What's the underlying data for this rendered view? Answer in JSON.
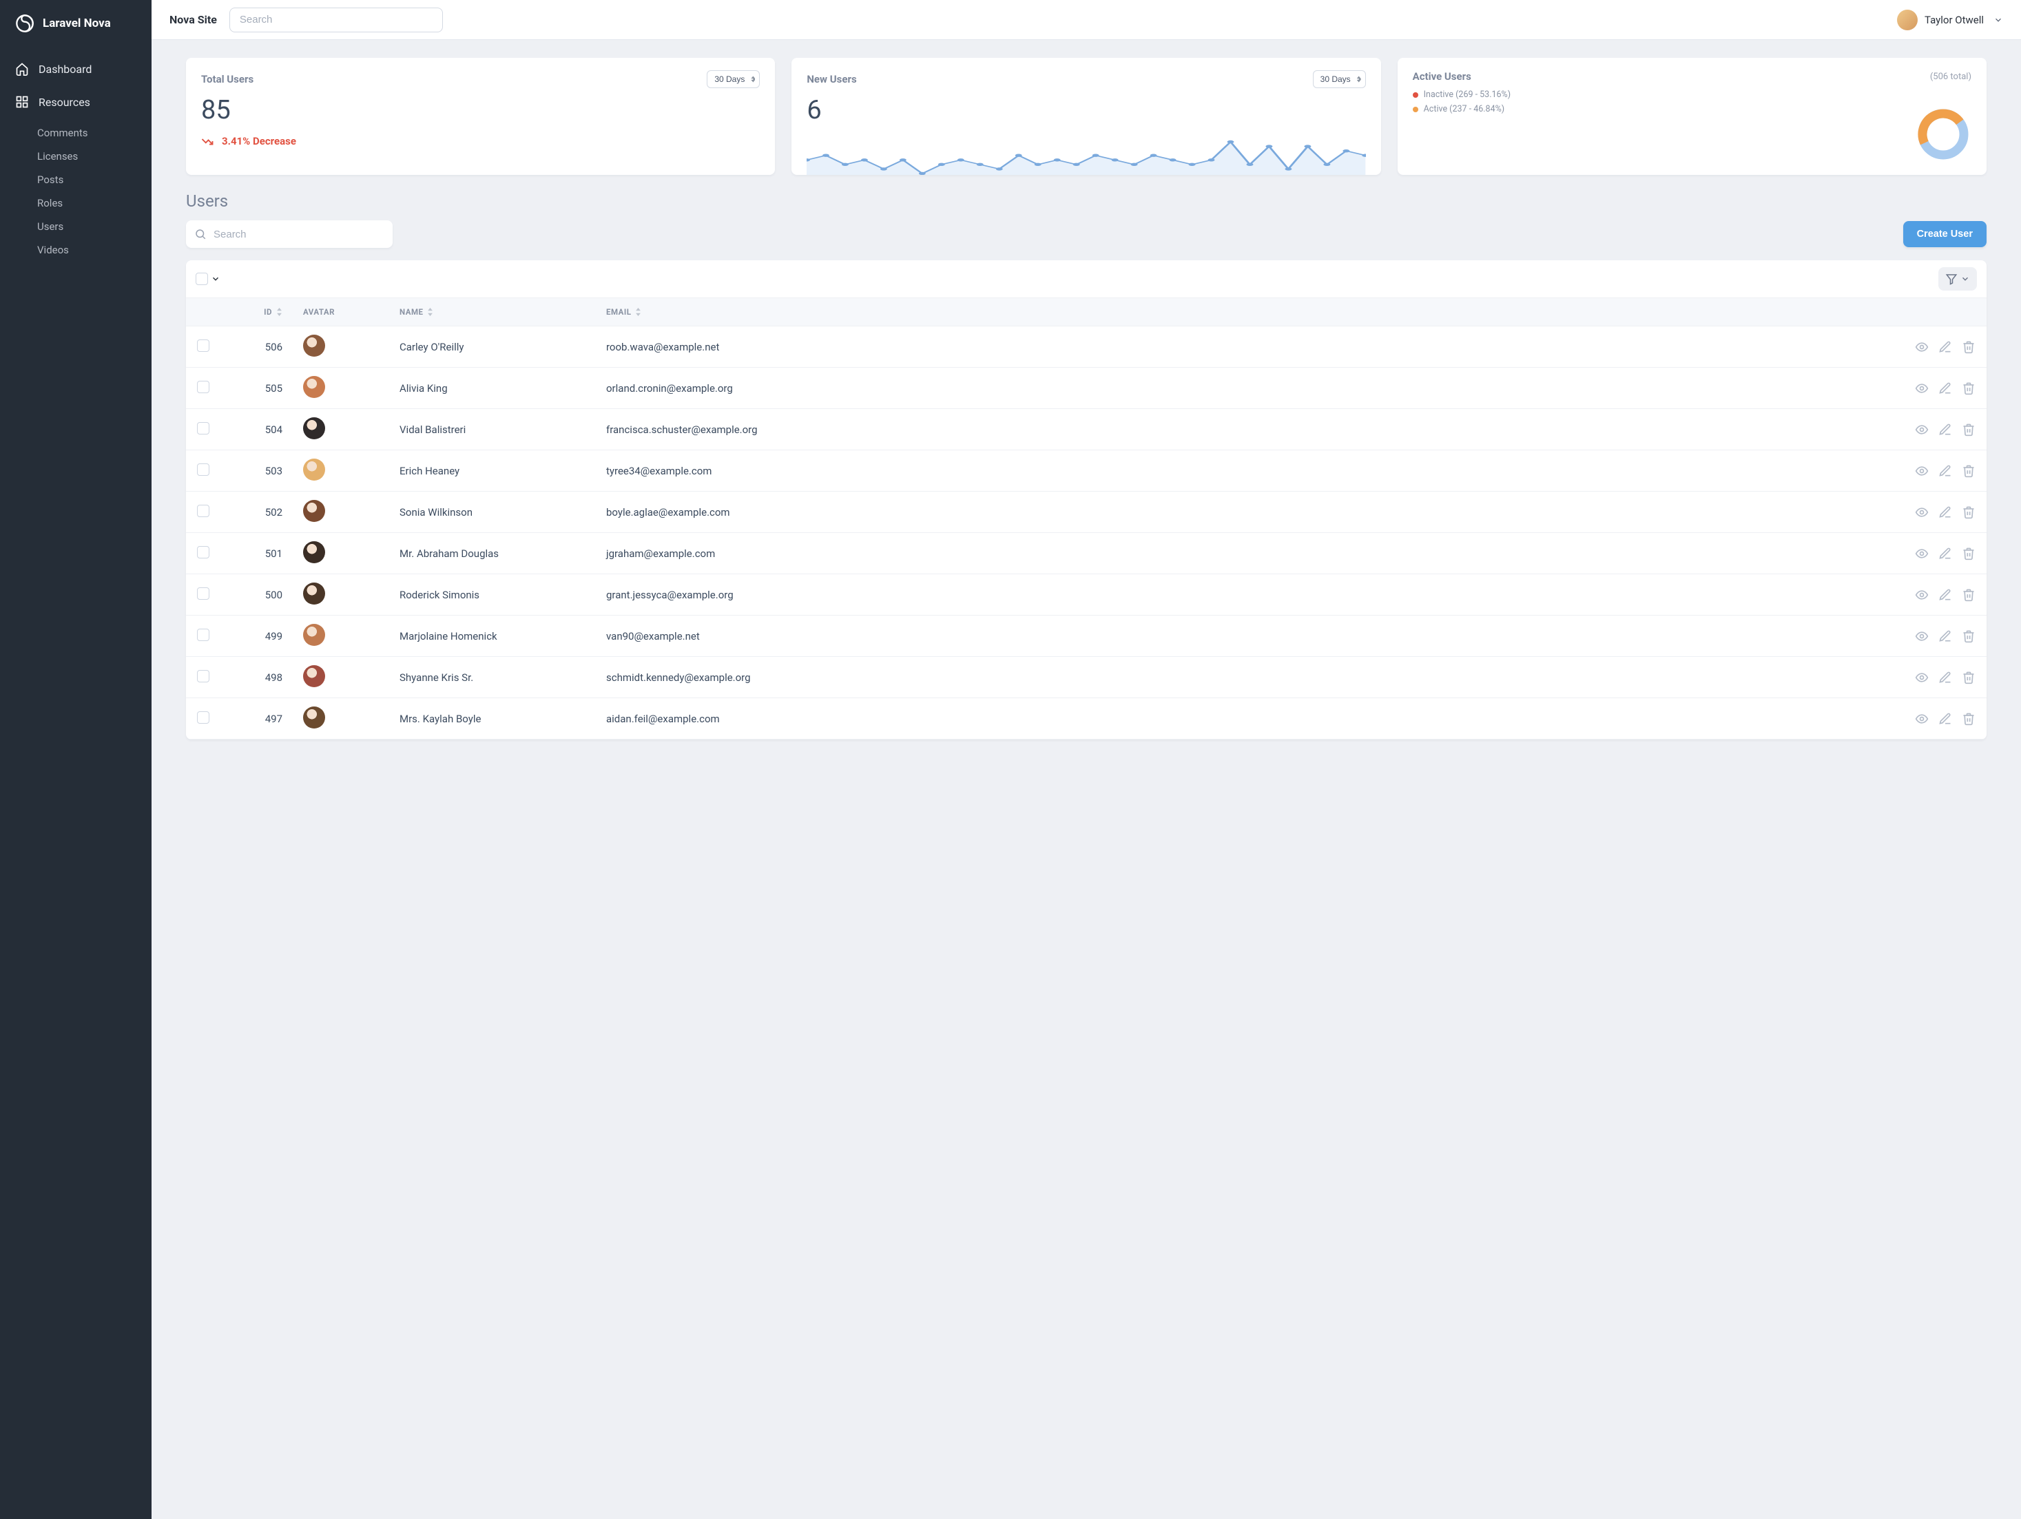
{
  "brand": {
    "name": "Laravel Nova"
  },
  "topbar": {
    "site_title": "Nova Site",
    "search_placeholder": "Search",
    "user_name": "Taylor Otwell"
  },
  "sidebar": {
    "dashboard_label": "Dashboard",
    "resources_label": "Resources",
    "resources": [
      {
        "label": "Comments"
      },
      {
        "label": "Licenses"
      },
      {
        "label": "Posts"
      },
      {
        "label": "Roles"
      },
      {
        "label": "Users"
      },
      {
        "label": "Videos"
      }
    ]
  },
  "metrics": {
    "total_users": {
      "title": "Total Users",
      "range": "30 Days",
      "value": "85",
      "trend_text": "3.41% Decrease"
    },
    "new_users": {
      "title": "New Users",
      "range": "30 Days",
      "value": "6"
    },
    "active_users": {
      "title": "Active Users",
      "total_text": "(506 total)",
      "legend": {
        "inactive": {
          "label": "Inactive (269 - 53.16%)",
          "color": "#e15241"
        },
        "active": {
          "label": "Active (237 - 46.84%)",
          "color": "#f0a04b"
        }
      }
    }
  },
  "chart_data": [
    {
      "type": "line",
      "title": "New Users",
      "x": [
        1,
        2,
        3,
        4,
        5,
        6,
        7,
        8,
        9,
        10,
        11,
        12,
        13,
        14,
        15,
        16,
        17,
        18,
        19,
        20,
        21,
        22,
        23,
        24,
        25,
        26,
        27,
        28,
        29,
        30
      ],
      "values": [
        5,
        6,
        4,
        5,
        3,
        5,
        2,
        4,
        5,
        4,
        3,
        6,
        4,
        5,
        4,
        6,
        5,
        4,
        6,
        5,
        4,
        5,
        9,
        4,
        8,
        3,
        8,
        4,
        7,
        6
      ]
    },
    {
      "type": "pie",
      "title": "Active Users",
      "series": [
        {
          "name": "Inactive",
          "value": 269,
          "pct": 53.16,
          "color": "#a9cbef"
        },
        {
          "name": "Active",
          "value": 237,
          "pct": 46.84,
          "color": "#f0a04b"
        }
      ],
      "total": 506
    }
  ],
  "list": {
    "section_title": "Users",
    "search_placeholder": "Search",
    "create_label": "Create User",
    "columns": {
      "id": "ID",
      "avatar": "Avatar",
      "name": "Name",
      "email": "Email"
    },
    "rows": [
      {
        "id": "506",
        "name": "Carley O'Reilly",
        "email": "roob.wava@example.net",
        "avatar_color": "#8a5a3c"
      },
      {
        "id": "505",
        "name": "Alivia King",
        "email": "orland.cronin@example.org",
        "avatar_color": "#c97b4e"
      },
      {
        "id": "504",
        "name": "Vidal Balistreri",
        "email": "francisca.schuster@example.org",
        "avatar_color": "#2f2a2a"
      },
      {
        "id": "503",
        "name": "Erich Heaney",
        "email": "tyree34@example.com",
        "avatar_color": "#e4b06b"
      },
      {
        "id": "502",
        "name": "Sonia Wilkinson",
        "email": "boyle.aglae@example.com",
        "avatar_color": "#7a4a30"
      },
      {
        "id": "501",
        "name": "Mr. Abraham Douglas",
        "email": "jgraham@example.com",
        "avatar_color": "#3a2d25"
      },
      {
        "id": "500",
        "name": "Roderick Simonis",
        "email": "grant.jessyca@example.org",
        "avatar_color": "#4a3627"
      },
      {
        "id": "499",
        "name": "Marjolaine Homenick",
        "email": "van90@example.net",
        "avatar_color": "#c07a4f"
      },
      {
        "id": "498",
        "name": "Shyanne Kris Sr.",
        "email": "schmidt.kennedy@example.org",
        "avatar_color": "#a14d3f"
      },
      {
        "id": "497",
        "name": "Mrs. Kaylah Boyle",
        "email": "aidan.feil@example.com",
        "avatar_color": "#6b4a2e"
      }
    ]
  }
}
